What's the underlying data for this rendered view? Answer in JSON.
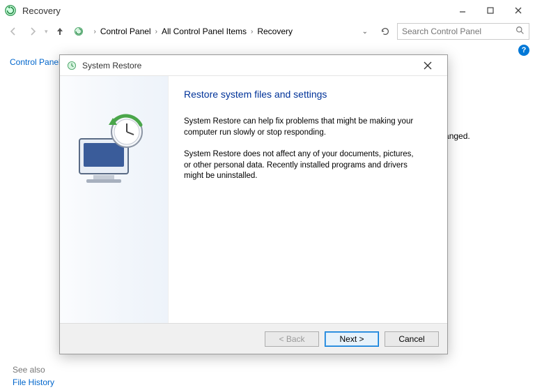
{
  "window": {
    "title": "Recovery",
    "controls": {
      "minimize": true,
      "maximize": true,
      "close": true
    }
  },
  "nav": {
    "back_enabled": false,
    "forward_enabled": false,
    "up_enabled": true,
    "breadcrumbs": [
      "Control Panel",
      "All Control Panel Items",
      "Recovery"
    ],
    "sep": "›",
    "refresh_tooltip": "Refresh"
  },
  "search": {
    "placeholder": "Search Control Panel"
  },
  "sidebar": {
    "home": "Control Panel Home",
    "see_also": "See also",
    "file_history": "File History"
  },
  "background_partial": "ic unchanged.",
  "help_badge": "?",
  "dialog": {
    "title": "System Restore",
    "heading": "Restore system files and settings",
    "para1": "System Restore can help fix problems that might be making your computer run slowly or stop responding.",
    "para2": "System Restore does not affect any of your documents, pictures, or other personal data. Recently installed programs and drivers might be uninstalled.",
    "buttons": {
      "back": "< Back",
      "next": "Next >",
      "cancel": "Cancel"
    }
  }
}
